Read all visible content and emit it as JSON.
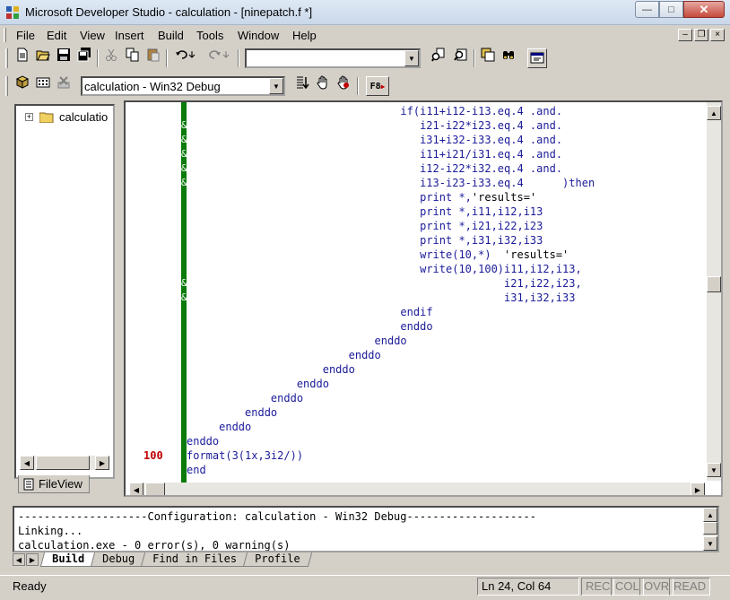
{
  "window": {
    "title": "Microsoft Developer Studio - calculation - [ninepatch.f *]",
    "minimize": "0",
    "maximize": "1",
    "close": "r"
  },
  "menu": {
    "items": [
      "File",
      "Edit",
      "View",
      "Insert",
      "Build",
      "Tools",
      "Window",
      "Help"
    ]
  },
  "toolbar2": {
    "config_combo": "calculation - Win32 Debug",
    "f8_label": "F8"
  },
  "workspace": {
    "tree_label": "calculatio",
    "tab_label": "FileView"
  },
  "editor": {
    "lines": [
      {
        "num": "",
        "amp": "",
        "text": "                                 if(i11+i12-i13.eq.4 .and."
      },
      {
        "num": "",
        "amp": "&",
        "text": "                                    i21-i22*i23.eq.4 .and."
      },
      {
        "num": "",
        "amp": "&",
        "text": "                                    i31+i32-i33.eq.4 .and."
      },
      {
        "num": "",
        "amp": "&",
        "text": "                                    i11+i21/i31.eq.4 .and."
      },
      {
        "num": "",
        "amp": "&",
        "text": "                                    i12-i22*i32.eq.4 .and."
      },
      {
        "num": "",
        "amp": "&",
        "text": "                                    i13-i23-i33.eq.4      )then"
      },
      {
        "num": "",
        "amp": "",
        "text": "                                    print *,'results='"
      },
      {
        "num": "",
        "amp": "",
        "text": "                                    print *,i11,i12,i13"
      },
      {
        "num": "",
        "amp": "",
        "text": "                                    print *,i21,i22,i23"
      },
      {
        "num": "",
        "amp": "",
        "text": "                                    print *,i31,i32,i33"
      },
      {
        "num": "",
        "amp": "",
        "text": "                                    write(10,*)  'results='"
      },
      {
        "num": "",
        "amp": "",
        "text": "                                    write(10,100)i11,i12,i13,"
      },
      {
        "num": "",
        "amp": "&",
        "text": "                                                 i21,i22,i23,"
      },
      {
        "num": "",
        "amp": "&",
        "text": "                                                 i31,i32,i33"
      },
      {
        "num": "",
        "amp": "",
        "text": "                                 endif"
      },
      {
        "num": "",
        "amp": "",
        "text": "                                 enddo"
      },
      {
        "num": "",
        "amp": "",
        "text": "                             enddo"
      },
      {
        "num": "",
        "amp": "",
        "text": "                         enddo"
      },
      {
        "num": "",
        "amp": "",
        "text": "                     enddo"
      },
      {
        "num": "",
        "amp": "",
        "text": "                 enddo"
      },
      {
        "num": "",
        "amp": "",
        "text": "             enddo"
      },
      {
        "num": "",
        "amp": "",
        "text": "         enddo"
      },
      {
        "num": "",
        "amp": "",
        "text": "     enddo"
      },
      {
        "num": "",
        "amp": "",
        "text": "enddo"
      },
      {
        "num": "100",
        "amp": "",
        "text": "format(3(1x,3i2/))"
      },
      {
        "num": "",
        "amp": "",
        "text": "end"
      }
    ]
  },
  "output": {
    "lines": [
      "--------------------Configuration: calculation - Win32 Debug--------------------",
      "Linking...",
      "calculation.exe - 0 error(s), 0 warning(s)"
    ],
    "tabs": [
      "Build",
      "Debug",
      "Find in Files",
      "Profile"
    ]
  },
  "status": {
    "text": "Ready",
    "position": "Ln 24, Col 64",
    "rec": "REC",
    "col": "COL",
    "ovr": "OVR",
    "read": "READ"
  }
}
